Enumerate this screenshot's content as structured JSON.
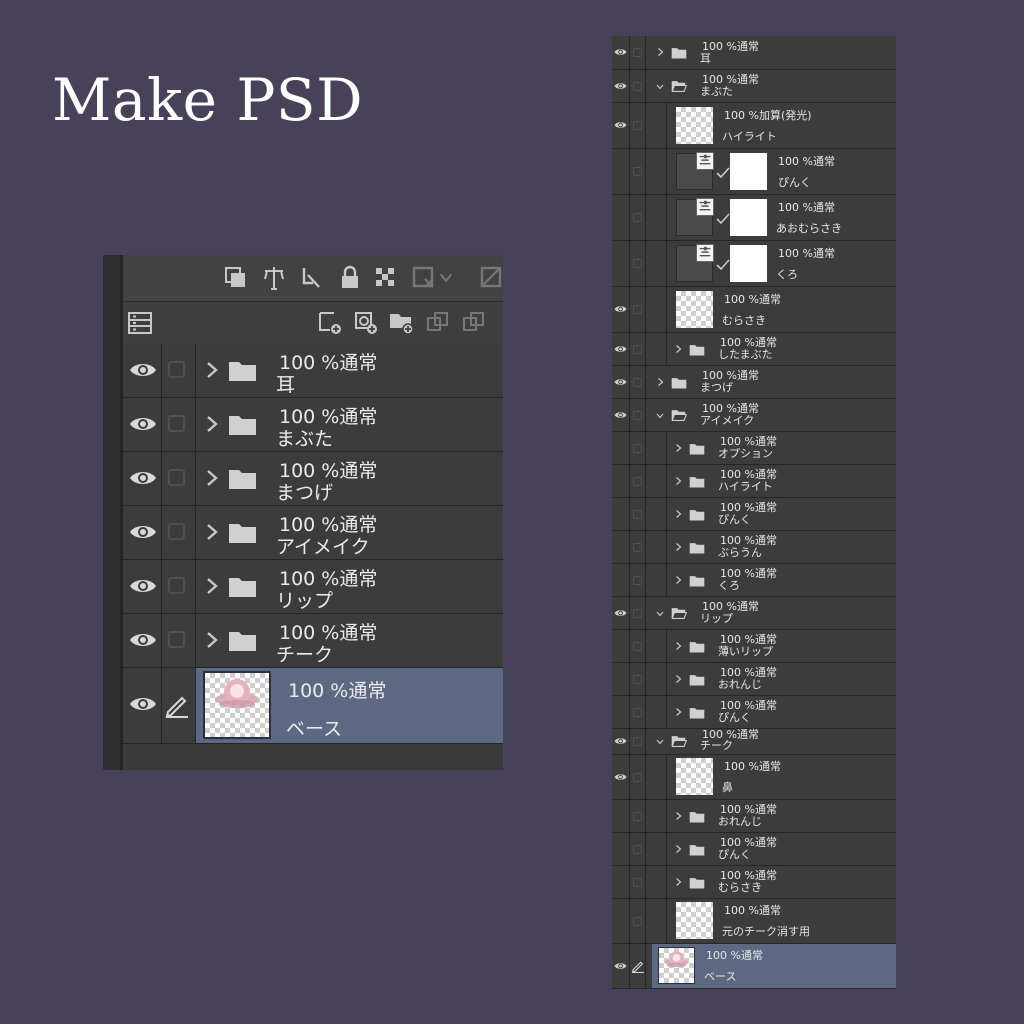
{
  "title": "Make PSD",
  "colors": {
    "background": "#47425a",
    "panel": "#3c3c3c",
    "selected": "#5d6983",
    "border": "#262626"
  },
  "icons": {
    "visibility": "eye-icon",
    "folder": "folder-icon",
    "expand": "chevron-right-icon",
    "collapse": "chevron-down-icon",
    "edit": "pen-icon",
    "lock": "lock-icon"
  },
  "left_panel": {
    "layers": [
      {
        "mode": "100 %通常",
        "name": "耳"
      },
      {
        "mode": "100 %通常",
        "name": "まぶた"
      },
      {
        "mode": "100 %通常",
        "name": "まつげ"
      },
      {
        "mode": "100 %通常",
        "name": "アイメイク"
      },
      {
        "mode": "100 %通常",
        "name": "リップ"
      },
      {
        "mode": "100 %通常",
        "name": "チーク"
      }
    ],
    "base": {
      "mode": "100 %通常",
      "name": "ベース"
    }
  },
  "right_panel": {
    "rows": [
      {
        "mode": "100 %通常",
        "name": "耳"
      },
      {
        "mode": "100 %通常",
        "name": "まぶた"
      },
      {
        "mode": "100 %加算(発光)",
        "name": "ハイライト"
      },
      {
        "mode": "100 %通常",
        "name": "ぴんく"
      },
      {
        "mode": "100 %通常",
        "name": "あおむらさき"
      },
      {
        "mode": "100 %通常",
        "name": "くろ"
      },
      {
        "mode": "100 %通常",
        "name": "むらさき"
      },
      {
        "mode": "100 %通常",
        "name": "したまぶた"
      },
      {
        "mode": "100 %通常",
        "name": "まつげ"
      },
      {
        "mode": "100 %通常",
        "name": "アイメイク"
      },
      {
        "mode": "100 %通常",
        "name": "オプション"
      },
      {
        "mode": "100 %通常",
        "name": "ハイライト"
      },
      {
        "mode": "100 %通常",
        "name": "ぴんく"
      },
      {
        "mode": "100 %通常",
        "name": "ぶらうん"
      },
      {
        "mode": "100 %通常",
        "name": "くろ"
      },
      {
        "mode": "100 %通常",
        "name": "リップ"
      },
      {
        "mode": "100 %通常",
        "name": "薄いリップ"
      },
      {
        "mode": "100 %通常",
        "name": "おれんじ"
      },
      {
        "mode": "100 %通常",
        "name": "ぴんく"
      },
      {
        "mode": "100 %通常",
        "name": "チーク"
      },
      {
        "mode": "100 %通常",
        "name": "鼻"
      },
      {
        "mode": "100 %通常",
        "name": "おれんじ"
      },
      {
        "mode": "100 %通常",
        "name": "ぴんく"
      },
      {
        "mode": "100 %通常",
        "name": "むらさき"
      },
      {
        "mode": "100 %通常",
        "name": "元のチーク消す用"
      },
      {
        "mode": "100 %通常",
        "name": "ベース"
      }
    ]
  }
}
